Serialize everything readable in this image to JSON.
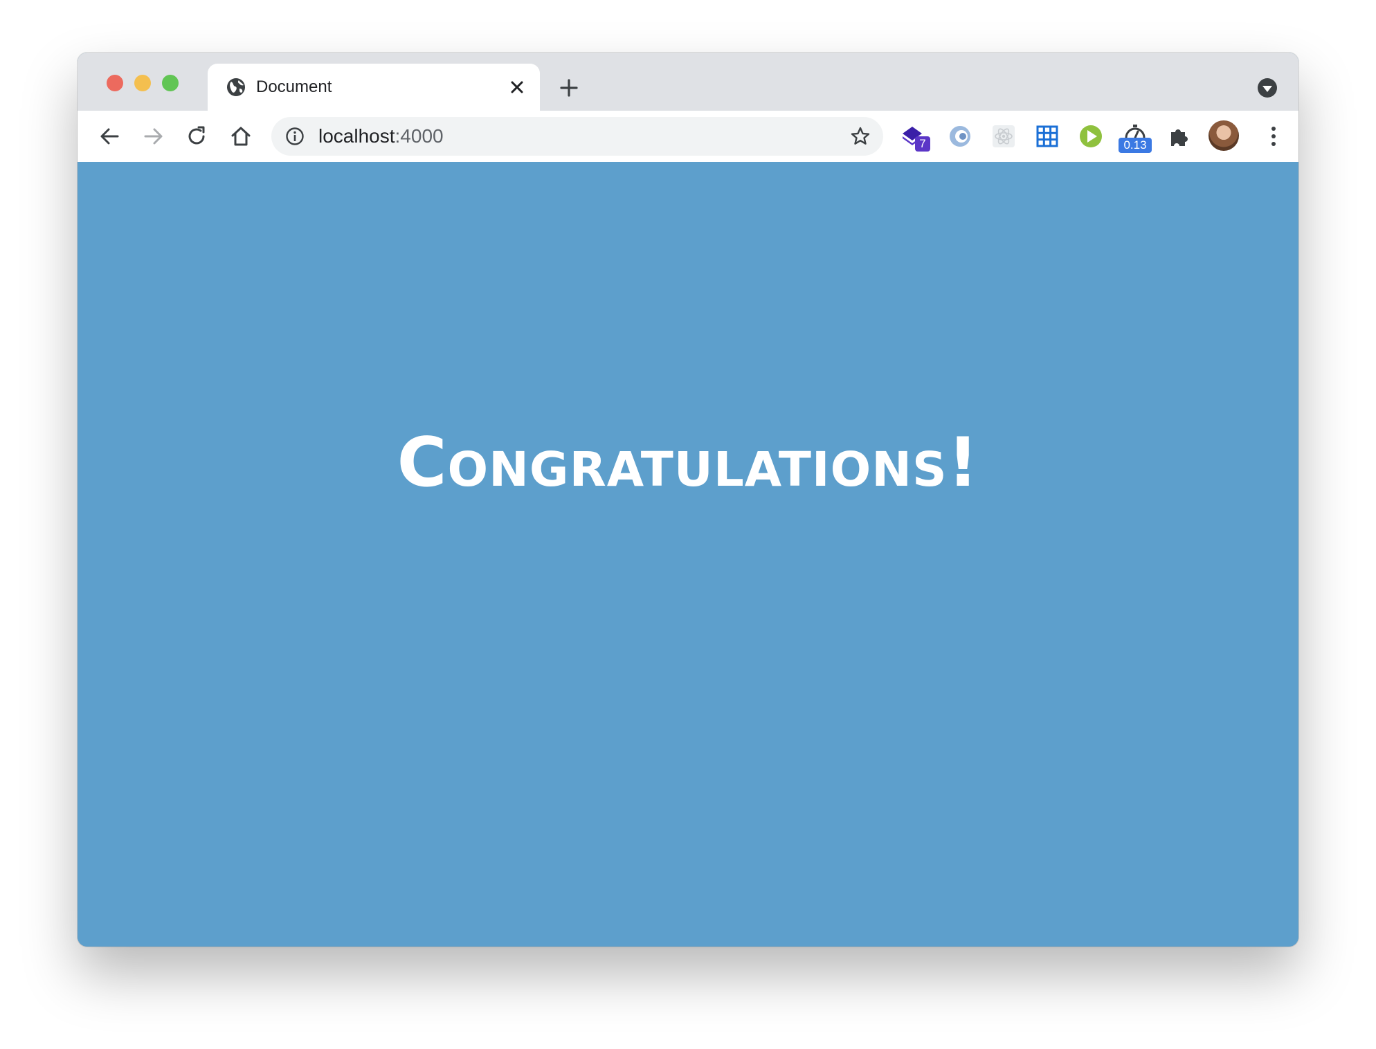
{
  "browser": {
    "tab": {
      "title": "Document"
    },
    "address": {
      "host": "localhost",
      "port": ":4000"
    },
    "extensions": [
      {
        "name": "stacked-diamond-extension",
        "badge": "7",
        "badge_color": "#5b36c7"
      },
      {
        "name": "blue-orb-extension"
      },
      {
        "name": "react-devtools-extension"
      },
      {
        "name": "grid-extension"
      },
      {
        "name": "green-play-extension"
      },
      {
        "name": "timer-extension",
        "badge": "0.13",
        "badge_color": "#3b79e3"
      },
      {
        "name": "puzzle-extensions-icon"
      }
    ]
  },
  "page": {
    "headline": "Congratulations!",
    "background": "#5d9fcc"
  }
}
